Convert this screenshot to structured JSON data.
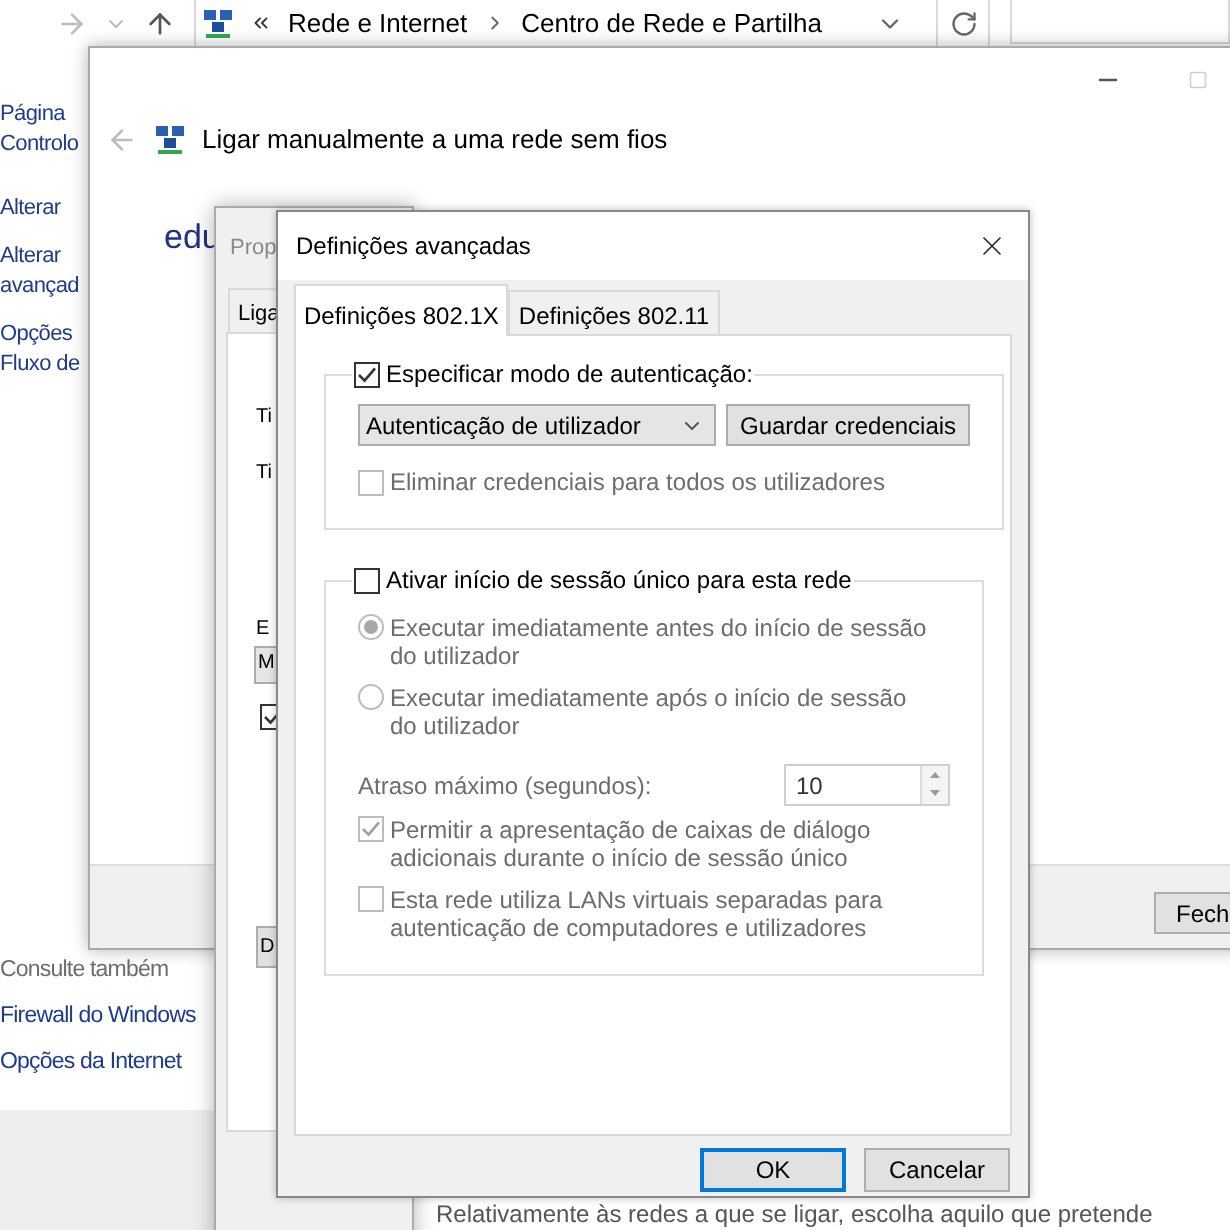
{
  "explorer": {
    "crumbs": [
      "Rede e Internet",
      "Centro de Rede e Partilha"
    ],
    "sidebar_links": [
      {
        "lines": [
          "Página",
          "Controlo"
        ]
      },
      {
        "lines": [
          "Alterar"
        ]
      },
      {
        "lines": [
          "Alterar",
          "avançad"
        ]
      },
      {
        "lines": [
          "Opções",
          "Fluxo de"
        ]
      }
    ],
    "see_also": {
      "heading": "Consulte também",
      "links": [
        "Firewall do Windows",
        "Opções da Internet"
      ]
    },
    "footer_text": "Relativamente às redes a que se ligar, escolha aquilo que pretende"
  },
  "wizard": {
    "title": "Ligar manualmente a uma rede sem fios",
    "network_name": "edu",
    "close_button": "Fech"
  },
  "properties": {
    "title": "Prop",
    "tab": "Liga",
    "labels": [
      "Ti",
      "Ti",
      "E"
    ],
    "combo": "M",
    "checkbox": {
      "checked": true
    },
    "button": "D"
  },
  "advanced": {
    "title": "Definições avançadas",
    "tabs": [
      {
        "label": "Definições 802.1X",
        "selected": true
      },
      {
        "label": "Definições 802.11",
        "selected": false
      }
    ],
    "auth": {
      "label": "Especificar modo de autenticação:",
      "checked": true,
      "mode": "Autenticação de utilizador",
      "save_button": "Guardar credenciais",
      "delete_option": {
        "label": "Eliminar credenciais para todos os utilizadores",
        "checked": false,
        "disabled": true
      }
    },
    "sso": {
      "label": "Ativar início de sessão único para esta rede",
      "checked": false,
      "options": [
        {
          "label": "Executar imediatamente antes do início de sessão do utilizador",
          "selected": true,
          "disabled": true
        },
        {
          "label": "Executar imediatamente após o início de sessão do utilizador",
          "selected": false,
          "disabled": true
        }
      ],
      "delay_label": "Atraso máximo (segundos):",
      "delay_value": "10",
      "delay_disabled": true,
      "checks": [
        {
          "label": "Permitir a apresentação de caixas de diálogo adicionais durante o início de sessão único",
          "checked": true,
          "disabled": true
        },
        {
          "label": "Esta rede utiliza LANs virtuais separadas para autenticação de computadores e utilizadores",
          "checked": false,
          "disabled": true
        }
      ]
    },
    "buttons": [
      {
        "label": "OK",
        "default": true
      },
      {
        "label": "Cancelar",
        "default": false
      }
    ]
  }
}
